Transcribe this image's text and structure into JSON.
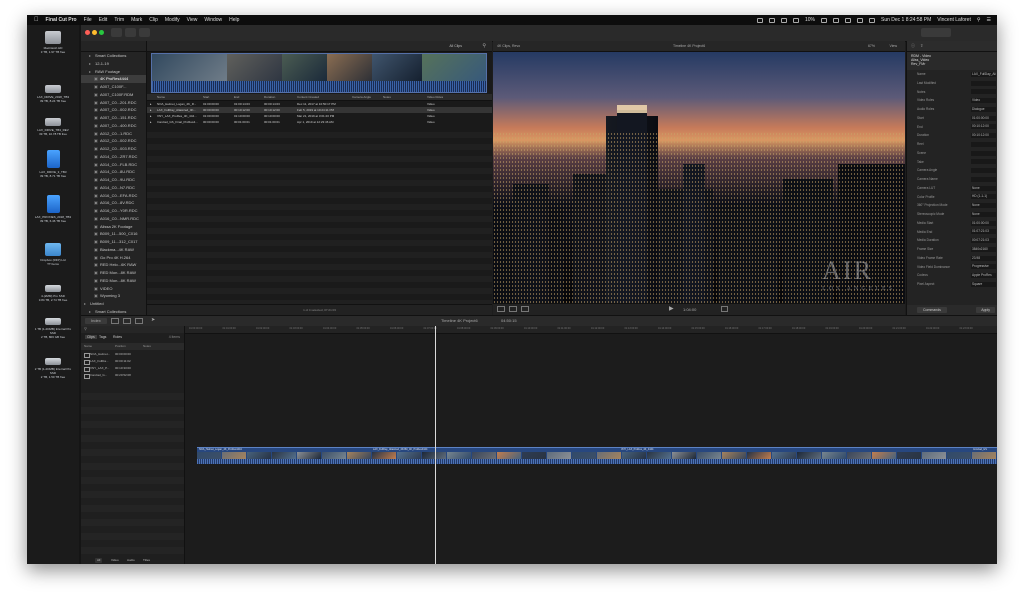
{
  "menubar": {
    "app": "Final Cut Pro",
    "items": [
      "File",
      "Edit",
      "Trim",
      "Mark",
      "Clip",
      "Modify",
      "View",
      "Window",
      "Help"
    ],
    "battery": "10%",
    "datetime": "Sun Dec 1  8:24:58 PM",
    "user": "Vincent Laforet"
  },
  "desktop": {
    "icons": [
      {
        "name": "Macintosh HD",
        "info": "3 TB, 1.97 TB free",
        "kind": "hd"
      },
      {
        "name": "LAX_DRIVE_2018_TB3",
        "info": "39 TB, 8.24 TB free",
        "kind": "hd"
      },
      {
        "name": "LAX_DRIVE_TB3_REV",
        "info": "39 TB, 10.78 TB free",
        "kind": "hd"
      },
      {
        "name": "LAX_DRIVE_3_TB3",
        "info": "39 TB, 8.71 TB free",
        "kind": "hd"
      },
      {
        "name": "LAX_PROXIES_2018_TB3",
        "info": "39 TB, 6.46 TB free",
        "kind": "drv"
      },
      {
        "name": "Dropbox (RFP) Ltd",
        "info": "TT Items",
        "kind": "fold"
      },
      {
        "name": "4-(2MM) Pro SSD",
        "info": "3.84 TB, 2.74 TB free",
        "kind": "usb"
      },
      {
        "name": "1 TB (1-2DMB) Internal Pro SSD",
        "info": "2 TB, 806 GB free",
        "kind": "usb"
      },
      {
        "name": "2 TB (1-2DMB) Internal Pro SSD",
        "info": "2 TB, 1.50 TB free",
        "kind": "usb"
      }
    ]
  },
  "library": {
    "items": [
      {
        "label": "Smart Collections",
        "indent": 1
      },
      {
        "label": "12-1-19",
        "indent": 1
      },
      {
        "label": "RAW Footage",
        "indent": 1
      },
      {
        "label": "4K ProRes4444",
        "indent": 2,
        "sel": true
      },
      {
        "label": "A007_C100F...",
        "indent": 2
      },
      {
        "label": "A007_C100F.RDM",
        "indent": 2
      },
      {
        "label": "A007_C0...201.RDC",
        "indent": 2
      },
      {
        "label": "A007_C0...002.RDC",
        "indent": 2
      },
      {
        "label": "A007_C0...151.RDC",
        "indent": 2
      },
      {
        "label": "A007_C0...400.RDC",
        "indent": 2
      },
      {
        "label": "A012_C0...1.RDC",
        "indent": 2
      },
      {
        "label": "A012_C0...002.RDC",
        "indent": 2
      },
      {
        "label": "A012_C0...003.RDC",
        "indent": 2
      },
      {
        "label": "A014_C0...ZR7.RDC",
        "indent": 2
      },
      {
        "label": "A014_C0...FLB.RDC",
        "indent": 2
      },
      {
        "label": "A014_C0...8U.RDC",
        "indent": 2
      },
      {
        "label": "A014_C0...9U.RDC",
        "indent": 2
      },
      {
        "label": "A014_C0...N7.RDC",
        "indent": 2
      },
      {
        "label": "A016_C0...EFA.RDC",
        "indent": 2
      },
      {
        "label": "A016_C0...8V.RDC",
        "indent": 2
      },
      {
        "label": "A016_C0...Y0R.RDC",
        "indent": 2
      },
      {
        "label": "A016_C0...NMR.RDC",
        "indent": 2
      },
      {
        "label": "Alissa 2K Footage",
        "indent": 2
      },
      {
        "label": "B009_11...500_C016",
        "indent": 2
      },
      {
        "label": "B009_11...312_C017",
        "indent": 2
      },
      {
        "label": "Blackma...4K RAW",
        "indent": 2
      },
      {
        "label": "Go Pro 4K H.264",
        "indent": 2
      },
      {
        "label": "RED Helo...6K RAW",
        "indent": 2
      },
      {
        "label": "RED Mon...8K RAW",
        "indent": 2
      },
      {
        "label": "RED Mon...8K RAW",
        "indent": 2
      },
      {
        "label": "VIDEO",
        "indent": 2
      },
      {
        "label": "Wyoming 3",
        "indent": 2
      },
      {
        "label": "Untitled",
        "indent": 0
      },
      {
        "label": "Smart Collections",
        "indent": 1
      },
      {
        "label": "12-1-19",
        "indent": 1
      }
    ]
  },
  "browser": {
    "header_right": "All Clips",
    "columns": [
      "Name",
      "Start",
      "End",
      "Duration",
      "Content Created",
      "Camera Angle",
      "Notes",
      "Video Roles"
    ],
    "rows": [
      [
        "NOA_Helmet_Logan_4K_R...",
        "01:00:00:00",
        "01:00:14:03",
        "00:00:14:03",
        "Dec 11, 2017 at 10:50:17 PM",
        "",
        "",
        "Video"
      ],
      [
        "LAX_FullDay_Aliasized_4K...",
        "00:00:00:00",
        "00:10:12:00",
        "00:10:12:00",
        "Feb 5, 2019 at 10:24:11 PM",
        "",
        "",
        "Video"
      ],
      [
        "VNY_LAX_ProRes_4K_444...",
        "01:00:00:00",
        "01:10:00:00",
        "00:10:00:00",
        "Mar 21, 2019 at 3:01:20 PM",
        "",
        "",
        "Video"
      ],
      [
        "Ironclad_GS_Final_ProRes4...",
        "00:00:00:00",
        "00:01:00:01",
        "00:01:00:01",
        "Apr 1, 2019 at 12:23:46 AM",
        "",
        "",
        "Video"
      ]
    ],
    "footer": "1 of 4 selected, 07:21:03"
  },
  "viewer": {
    "left_label": "4K Clips, Revo",
    "title": "Timeline 4K Project6",
    "zoom": "67%",
    "view_label": "View",
    "timecode": "1:04:00",
    "watermark": "AIR",
    "watermark_sub": "LOS ANGELES"
  },
  "inspector": {
    "title": "RDM - Video",
    "subtitle": "Aliss_Video",
    "subtitle2": "Rev_FMr",
    "fields": [
      {
        "k": "Name",
        "v": "LAX_FullDay_Aliasized"
      },
      {
        "k": "Last Modified",
        "v": ""
      },
      {
        "k": "Notes",
        "v": ""
      },
      {
        "k": "Video Roles",
        "v": "Video"
      },
      {
        "k": "Audio Roles",
        "v": "Dialogue"
      },
      {
        "k": "Start",
        "v": "01:00:00:00"
      },
      {
        "k": "End",
        "v": "00:10:12:00"
      },
      {
        "k": "Duration",
        "v": "00:10:12:00"
      },
      {
        "k": "Reel",
        "v": ""
      },
      {
        "k": "Scene",
        "v": ""
      },
      {
        "k": "Take",
        "v": ""
      },
      {
        "k": "Camera Angle",
        "v": ""
      },
      {
        "k": "Camera Name",
        "v": ""
      },
      {
        "k": "Camera LUT",
        "v": "None"
      },
      {
        "k": "Color Profile",
        "v": "HD (1-1-1)"
      },
      {
        "k": "360° Projection Mode",
        "v": "None"
      },
      {
        "k": "Stereoscopic Mode",
        "v": "None"
      },
      {
        "k": "Media Start",
        "v": "01:00:00:00"
      },
      {
        "k": "Media End",
        "v": "01:07:21:03"
      },
      {
        "k": "Media Duration",
        "v": "00:07:21:03"
      },
      {
        "k": "Frame Size",
        "v": "3840x2160"
      },
      {
        "k": "Video Frame Rate",
        "v": "23.98"
      },
      {
        "k": "Video Field Dominance",
        "v": "Progressive"
      },
      {
        "k": "Codecs",
        "v": "Apple ProRes"
      },
      {
        "k": "Pixel Aspect",
        "v": "Square"
      }
    ],
    "button": "Apply",
    "footer_left": "Commands"
  },
  "timeline": {
    "title": "Timeline 4K Project6",
    "duration": "04:50:15",
    "index_label": "Index",
    "index_tabs": [
      "Clips",
      "Tags",
      "Roles"
    ],
    "index_count": "4 items",
    "index_columns": [
      "Name",
      "Position",
      "Notes"
    ],
    "index_rows": [
      [
        "NOA_Helmet...",
        "00:00:00:00",
        ""
      ],
      [
        "LAX_FullDa...",
        "00:00:11:02",
        ""
      ],
      [
        "VNY_LAX_P...",
        "00:10:33:00",
        ""
      ],
      [
        "Ironclad_G...",
        "00:20:52:08",
        ""
      ]
    ],
    "index_footer": [
      "All",
      "Video",
      "Audio",
      "Titles"
    ],
    "ruler": [
      "01:00:00:00",
      "01:01:00:00",
      "01:02:00:00",
      "01:03:00:00",
      "01:04:00:00",
      "01:05:00:00",
      "01:06:00:00",
      "01:07:00:00",
      "01:08:00:00",
      "01:09:00:00",
      "01:10:00:00",
      "01:11:00:00",
      "01:12:00:00",
      "01:13:00:00",
      "01:14:00:00",
      "01:15:00:00",
      "01:16:00:00",
      "01:17:00:00",
      "01:18:00:00",
      "01:19:00:00",
      "01:20:00:00",
      "01:21:00:00",
      "01:22:00:00",
      "01:23:00:00"
    ],
    "clips": [
      {
        "name": "NOA_Helmet_Logan_4K_ProRes4444"
      },
      {
        "name": "LAX_FullDay_Aliasized_4K360_4K_ProRes4444"
      },
      {
        "name": "VNY_LAX_ProRes_4K_4444"
      },
      {
        "name": "Ironclad_GS"
      }
    ]
  }
}
